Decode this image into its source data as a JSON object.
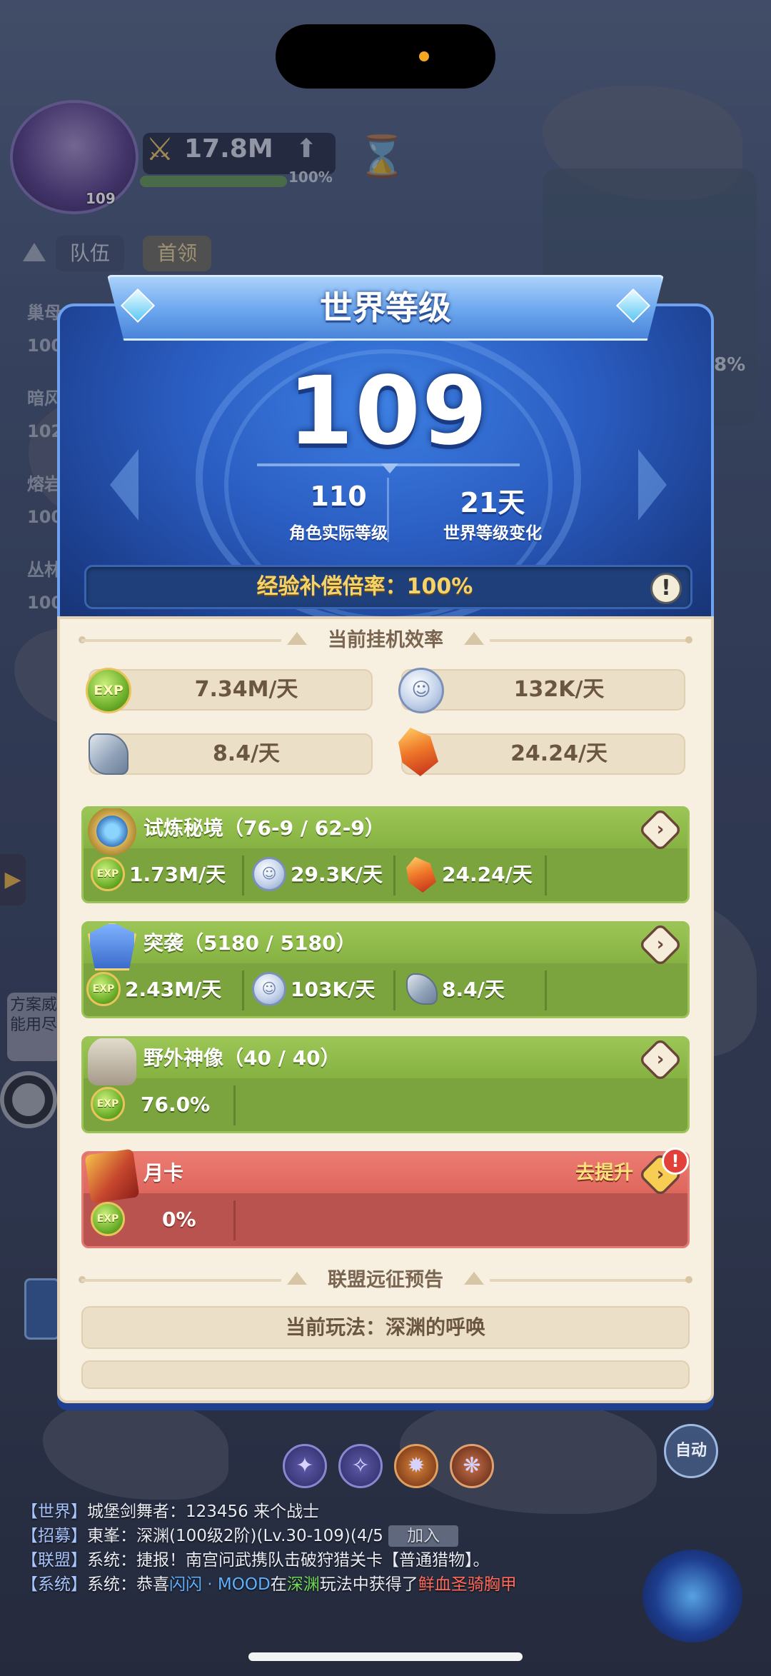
{
  "hud": {
    "avatar_level": "109",
    "power_value": "17.8M",
    "power_progress_pct": "100%",
    "tabs": [
      "队伍",
      "首领"
    ],
    "side_labels": [
      "巢母",
      "100",
      "暗风",
      "102",
      "熔岩",
      "100",
      "丛林",
      "100"
    ],
    "right_pct": "8%",
    "bubble_text": "方案威能用尽"
  },
  "modal": {
    "title": "世界等级",
    "world_level": "109",
    "actual_level_value": "110",
    "actual_level_label": "角色实际等级",
    "change_value": "21天",
    "change_label": "世界等级变化",
    "exp_rate_text": "经验补偿倍率：100%",
    "info_icon": "!",
    "efficiency_title": "当前挂机效率",
    "efficiency": [
      {
        "icon": "exp-icon",
        "value": "7.34M/天"
      },
      {
        "icon": "coin-icon",
        "value": "132K/天"
      },
      {
        "icon": "stone-icon",
        "value": "8.4/天"
      },
      {
        "icon": "crystal-icon",
        "value": "24.24/天"
      }
    ],
    "sources": [
      {
        "title": "试炼秘境（76-9 / 62-9）",
        "icon": "trial-icon",
        "items": [
          {
            "icon": "exp-icon",
            "value": "1.73M/天"
          },
          {
            "icon": "coin-icon",
            "value": "29.3K/天"
          },
          {
            "icon": "crystal-icon",
            "value": "24.24/天"
          }
        ]
      },
      {
        "title": "突袭（5180 / 5180）",
        "icon": "raid-icon",
        "items": [
          {
            "icon": "exp-icon",
            "value": "2.43M/天"
          },
          {
            "icon": "coin-icon",
            "value": "103K/天"
          },
          {
            "icon": "stone-icon",
            "value": "8.4/天"
          }
        ]
      },
      {
        "title": "野外神像（40 / 40）",
        "icon": "statue-icon",
        "items": [
          {
            "icon": "exp-icon",
            "value": "76.0%"
          }
        ]
      },
      {
        "title": "月卡",
        "icon": "monthly-card-icon",
        "upgrade_label": "去提升",
        "alert": "!",
        "items": [
          {
            "icon": "exp-icon",
            "value": "0%"
          }
        ]
      }
    ],
    "alliance_title": "联盟远征预告",
    "alliance_mode": "当前玩法：深渊的呼唤"
  },
  "bottom": {
    "auto_label": "自动",
    "chat": [
      {
        "tag": "【世界】",
        "text": "城堡剑舞者：123456 来个战士"
      },
      {
        "tag": "【招募】",
        "text": "東峯：深渊(100级2阶)(Lv.30-109)(4/5",
        "button": "加入"
      },
      {
        "tag": "【联盟】",
        "text": "系统：捷报！南宫问武携队击破狩猎关卡【普通猎物】。"
      },
      {
        "tag": "【系统】",
        "pre": "系统：恭喜",
        "name": "闪闪 · MOOD",
        "mid": "在",
        "place": "深渊",
        "post": "玩法中获得了",
        "item": "鲜血圣骑胸甲"
      }
    ]
  },
  "colors": {
    "modal_blue": "#2a5cc0",
    "card_green": "#7ba43e",
    "card_red": "#b9534f",
    "gold_text": "#f5d36b",
    "parchment": "#f7efdf"
  }
}
